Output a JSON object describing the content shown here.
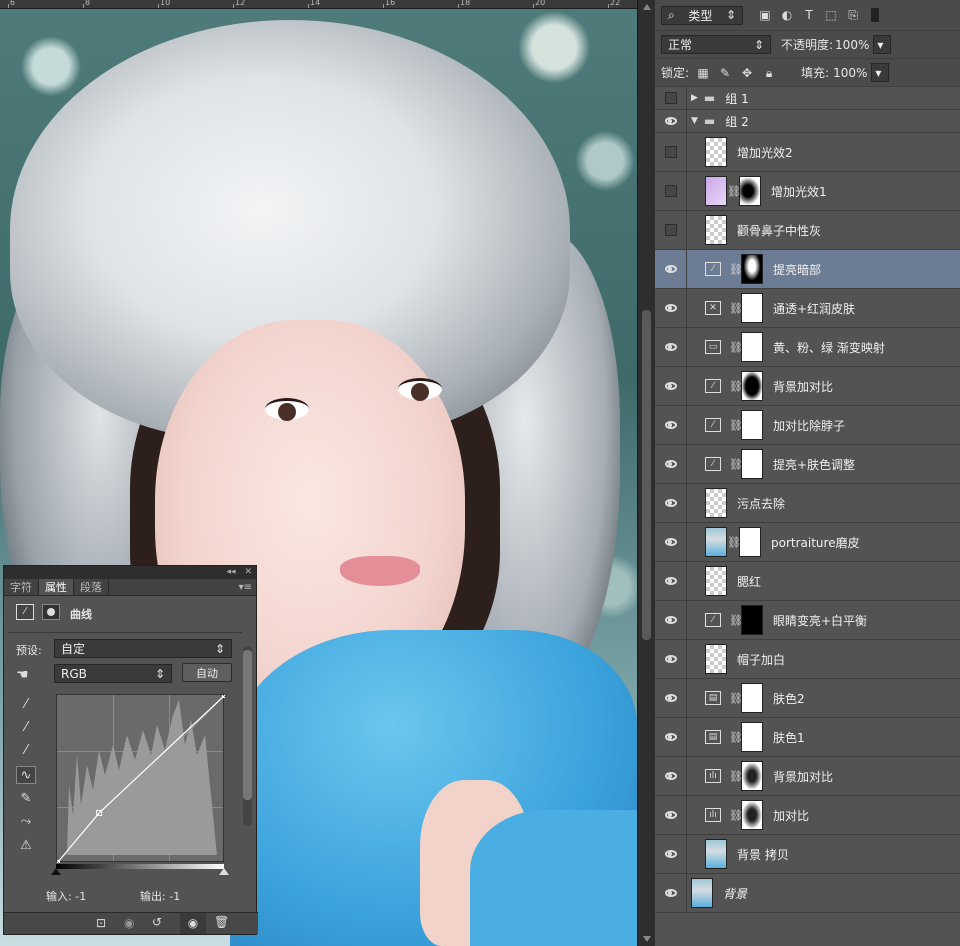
{
  "ruler": {
    "ticks": [
      "6",
      "8",
      "10",
      "12",
      "14",
      "16",
      "18",
      "20",
      "22"
    ]
  },
  "layers_panel": {
    "filter_kind": "类型",
    "blend_mode": "正常",
    "opacity_label": "不透明度:",
    "opacity_value": "100%",
    "lock_label": "锁定:",
    "fill_label": "填充:",
    "fill_value": "100%",
    "layers": [
      {
        "name": "组 1",
        "visible": false,
        "kind": "group-collapsed"
      },
      {
        "name": "组 2",
        "visible": true,
        "kind": "group-expanded"
      },
      {
        "name": "增加光效2",
        "visible": false,
        "kind": "pixel"
      },
      {
        "name": "增加光效1",
        "visible": false,
        "kind": "pixel-mask"
      },
      {
        "name": "颧骨鼻子中性灰",
        "visible": false,
        "kind": "pixel"
      },
      {
        "name": "提亮暗部",
        "visible": true,
        "kind": "curves",
        "selected": true
      },
      {
        "name": "通透+红润皮肤",
        "visible": true,
        "kind": "channel-mixer"
      },
      {
        "name": "黄、粉、绿 渐变映射",
        "visible": true,
        "kind": "gradient-map"
      },
      {
        "name": "背景加对比",
        "visible": true,
        "kind": "curves"
      },
      {
        "name": "加对比除脖子",
        "visible": true,
        "kind": "curves"
      },
      {
        "name": "提亮+肤色调整",
        "visible": true,
        "kind": "curves"
      },
      {
        "name": "污点去除",
        "visible": true,
        "kind": "pixel"
      },
      {
        "name": "portraiture磨皮",
        "visible": true,
        "kind": "photo-mask"
      },
      {
        "name": "腮红",
        "visible": true,
        "kind": "pixel"
      },
      {
        "name": "眼睛变亮+白平衡",
        "visible": true,
        "kind": "curves"
      },
      {
        "name": "帽子加白",
        "visible": true,
        "kind": "pixel"
      },
      {
        "name": "肤色2",
        "visible": true,
        "kind": "selective"
      },
      {
        "name": "肤色1",
        "visible": true,
        "kind": "selective"
      },
      {
        "name": "背景加对比",
        "visible": true,
        "kind": "levels"
      },
      {
        "name": "加对比",
        "visible": true,
        "kind": "levels"
      },
      {
        "name": "背景 拷贝",
        "visible": true,
        "kind": "photo"
      },
      {
        "name": "背景",
        "visible": true,
        "kind": "background"
      }
    ]
  },
  "properties_panel": {
    "tabs": [
      "字符",
      "属性",
      "段落"
    ],
    "active_tab": "属性",
    "title": "曲线",
    "preset_label": "预设:",
    "preset_value": "自定",
    "channel_value": "RGB",
    "auto_button": "自动",
    "input_label": "输入:",
    "input_value": "-1",
    "output_label": "输出:",
    "output_value": "-1",
    "collapse_icon": "◂◂",
    "close_icon": "✕"
  },
  "curve": {
    "points": [
      [
        0,
        0
      ],
      [
        64,
        76
      ],
      [
        255,
        255
      ]
    ]
  }
}
